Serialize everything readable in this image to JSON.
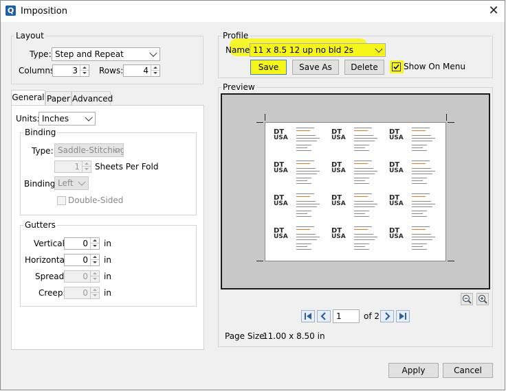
{
  "window": {
    "title": "Imposition",
    "app_icon": "Q",
    "close_glyph": "✕"
  },
  "layout": {
    "legend": "Layout",
    "type_label": "Type:",
    "type_value": "Step and Repeat",
    "columns_label": "Columns:",
    "columns_value": "3",
    "rows_label": "Rows:",
    "rows_value": "4"
  },
  "tabs": [
    "General",
    "Paper",
    "Advanced"
  ],
  "general": {
    "units_label": "Units:",
    "units_value": "Inches",
    "binding": {
      "legend": "Binding",
      "type_label": "Type:",
      "type_value": "Saddle-Stitching",
      "sheets_value": "1",
      "sheets_label": "Sheets Per Fold",
      "binding_label": "Binding:",
      "binding_value": "Left",
      "double_sided_label": "Double-Sided"
    },
    "gutters": {
      "legend": "Gutters",
      "vertical_label": "Vertical:",
      "vertical_value": "0",
      "horizontal_label": "Horizontal:",
      "horizontal_value": "0",
      "spread_label": "Spread:",
      "spread_value": "0",
      "creep_label": "Creep:",
      "creep_value": "0",
      "unit": "in"
    }
  },
  "profile": {
    "legend": "Profile",
    "name_label": "Name:",
    "name_value": "11 x 8.5 12 up no bld 2s",
    "save_label": "Save",
    "save_as_label": "Save As",
    "delete_label": "Delete",
    "show_on_menu_label": "Show On Menu",
    "show_on_menu_checked": true
  },
  "preview": {
    "legend": "Preview",
    "card_logo_top": "DT",
    "card_logo_bottom": "USA",
    "page_current": "1",
    "page_of": "of 2",
    "page_size_label": "Page Size:",
    "page_size_value": "11.00 x 8.50 in"
  },
  "footer": {
    "apply_label": "Apply",
    "cancel_label": "Cancel"
  },
  "colors": {
    "highlight": "#f6f61a",
    "accent": "#1f5fa8",
    "card_orange": "#e87722"
  }
}
